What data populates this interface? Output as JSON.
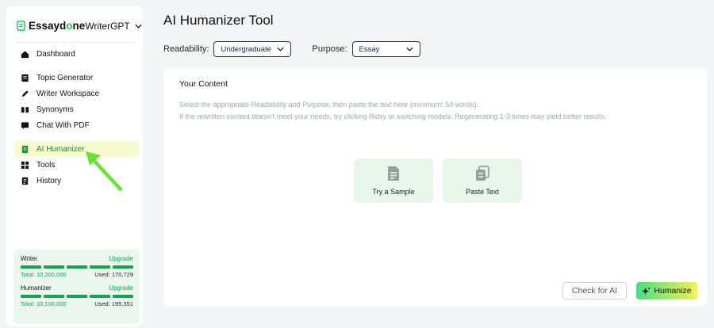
{
  "brand": {
    "name_prefix": "Essayd",
    "name_mark": "o",
    "name_suffix": "ne",
    "model": "WriterGPT"
  },
  "nav": {
    "dashboard": "Dashboard",
    "topic_generator": "Topic Generator",
    "writer_workspace": "Writer Workspace",
    "synonyms": "Synonyms",
    "chat_with_pdf": "Chat With PDF",
    "ai_humanizer": "AI Humanizer",
    "tools": "Tools",
    "history": "History"
  },
  "usage": {
    "writer": {
      "label": "Writer",
      "upgrade": "Upgrade",
      "total": "Total: 10,200,000",
      "used": "Used: 170,729"
    },
    "humanizer": {
      "label": "Humanizer",
      "upgrade": "Upgrade",
      "total": "Total: 10,100,000",
      "used": "Used: 195,351"
    }
  },
  "page": {
    "title": "AI Humanizer Tool"
  },
  "filters": {
    "readability_label": "Readability:",
    "readability_value": "Undergraduate",
    "purpose_label": "Purpose:",
    "purpose_value": "Essay"
  },
  "content": {
    "title": "Your Content",
    "hint_1": "Select the appropriate Readability and Purpose, then paste the text here (minimum: 50 words).",
    "hint_2": "If the rewritten content doesn't meet your needs, try clicking Retry or switching models. Regenerating 1-3 times may yield better results.",
    "sample_label": "Try a Sample",
    "paste_label": "Paste Text"
  },
  "actions": {
    "check": "Check for AI",
    "humanize": "Humanize"
  },
  "colors": {
    "accent": "#16a34a",
    "active_bg": "#f7fbcf",
    "arrow": "#6ee03a",
    "tile_bg": "#e9f6ec"
  }
}
